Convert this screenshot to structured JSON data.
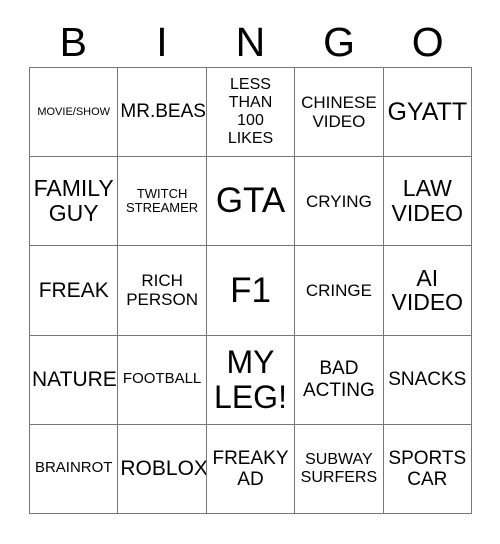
{
  "card": {
    "title": "BINGO",
    "header_letters": [
      "B",
      "I",
      "N",
      "G",
      "O"
    ],
    "border_color": "#777777",
    "text_color": "#000000",
    "background_color": "#ffffff",
    "columns": 5,
    "rows": 5,
    "cells": [
      [
        {
          "label": "MOVIE/SHOW",
          "size": "fs-xs",
          "marked": false
        },
        {
          "label": "MR.BEAST",
          "size": "fs-lg",
          "marked": false
        },
        {
          "label": "LESS\nTHAN\n100\nLIKES",
          "size": "fs-md",
          "marked": false
        },
        {
          "label": "CHINESE\nVIDEO",
          "size": "fs-md2",
          "marked": false
        },
        {
          "label": "GYATT",
          "size": "fs-xl2",
          "marked": false
        }
      ],
      [
        {
          "label": "FAMILY\nGUY",
          "size": "fs-xl",
          "marked": false
        },
        {
          "label": "TWITCH\nSTREAMER",
          "size": "fs-sm",
          "marked": false
        },
        {
          "label": "GTA",
          "size": "fs-xxxl",
          "marked": false
        },
        {
          "label": "CRYING",
          "size": "fs-md2",
          "marked": false
        },
        {
          "label": "LAW\nVIDEO",
          "size": "fs-xl",
          "marked": false
        }
      ],
      [
        {
          "label": "FREAK",
          "size": "fs-lg2",
          "marked": false
        },
        {
          "label": "RICH\nPERSON",
          "size": "fs-md2",
          "marked": false
        },
        {
          "label": "F1",
          "size": "fs-xxxl",
          "marked": false
        },
        {
          "label": "CRINGE",
          "size": "fs-md2",
          "marked": false
        },
        {
          "label": "AI\nVIDEO",
          "size": "fs-xl",
          "marked": false
        }
      ],
      [
        {
          "label": "NATURE",
          "size": "fs-lg2",
          "marked": false
        },
        {
          "label": "FOOTBALL",
          "size": "fs-smd",
          "marked": false
        },
        {
          "label": "MY\nLEG!",
          "size": "fs-xxl",
          "marked": false
        },
        {
          "label": "BAD\nACTING",
          "size": "fs-lg",
          "marked": false
        },
        {
          "label": "SNACKS",
          "size": "fs-lg",
          "marked": false
        }
      ],
      [
        {
          "label": "BRAINROT",
          "size": "fs-smd",
          "marked": false
        },
        {
          "label": "ROBLOX",
          "size": "fs-lg2",
          "marked": false
        },
        {
          "label": "FREAKY\nAD",
          "size": "fs-lg",
          "marked": false
        },
        {
          "label": "SUBWAY\nSURFERS",
          "size": "fs-md",
          "marked": false
        },
        {
          "label": "SPORTS\nCAR",
          "size": "fs-lg",
          "marked": false
        }
      ]
    ]
  }
}
